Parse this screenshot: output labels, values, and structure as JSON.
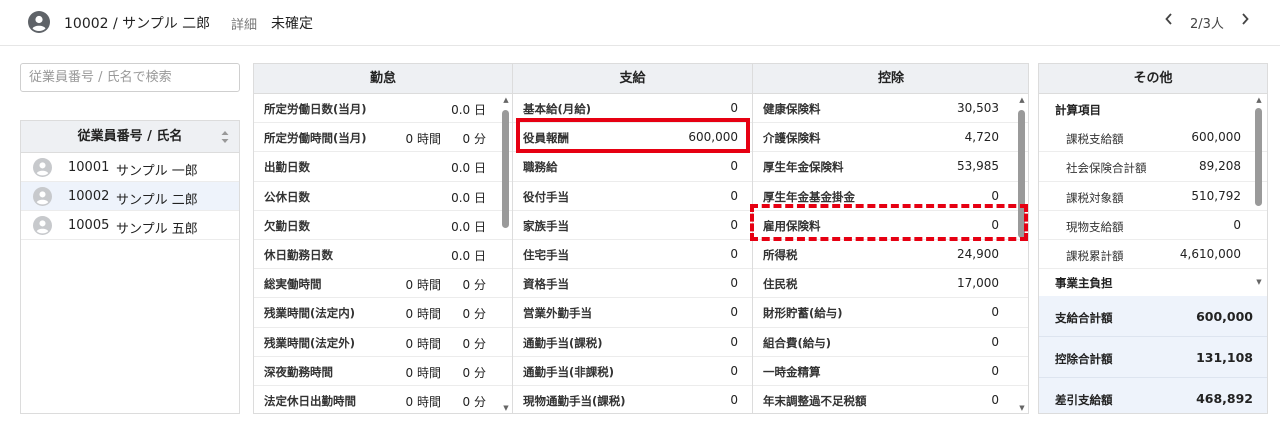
{
  "header": {
    "employee": "10002 / サンプル 二郎",
    "detail_label": "詳細",
    "status": "未確定",
    "pager": {
      "prev_icon": "chevron-left-icon",
      "count": "2/3人",
      "next_icon": "chevron-right-icon"
    }
  },
  "search": {
    "placeholder": "従業員番号 / 氏名で検索",
    "value": ""
  },
  "employee_list": {
    "header": "従業員番号 / 氏名",
    "rows": [
      {
        "id": "10001",
        "name": "サンプル 一郎",
        "selected": false
      },
      {
        "id": "10002",
        "name": "サンプル 二郎",
        "selected": true
      },
      {
        "id": "10005",
        "name": "サンプル 五郎",
        "selected": false
      }
    ]
  },
  "attendance": {
    "title": "勤怠",
    "rows": [
      {
        "label": "所定労働日数(当月)",
        "value": "0.0 日"
      },
      {
        "label": "所定労働時間(当月)",
        "h": "0 時間",
        "m": "0 分"
      },
      {
        "label": "出勤日数",
        "value": "0.0 日"
      },
      {
        "label": "公休日数",
        "value": "0.0 日"
      },
      {
        "label": "欠勤日数",
        "value": "0.0 日"
      },
      {
        "label": "休日勤務日数",
        "value": "0.0 日"
      },
      {
        "label": "総実働時間",
        "h": "0 時間",
        "m": "0 分"
      },
      {
        "label": "残業時間(法定内)",
        "h": "0 時間",
        "m": "0 分"
      },
      {
        "label": "残業時間(法定外)",
        "h": "0 時間",
        "m": "0 分"
      },
      {
        "label": "深夜勤務時間",
        "h": "0 時間",
        "m": "0 分"
      },
      {
        "label": "法定休日出勤時間",
        "h": "0 時間",
        "m": "0 分"
      }
    ]
  },
  "payments": {
    "title": "支給",
    "rows": [
      {
        "label": "基本給(月給)",
        "value": "0"
      },
      {
        "label": "役員報酬",
        "value": "600,000"
      },
      {
        "label": "職務給",
        "value": "0"
      },
      {
        "label": "役付手当",
        "value": "0"
      },
      {
        "label": "家族手当",
        "value": "0"
      },
      {
        "label": "住宅手当",
        "value": "0"
      },
      {
        "label": "資格手当",
        "value": "0"
      },
      {
        "label": "営業外勤手当",
        "value": "0"
      },
      {
        "label": "通勤手当(課税)",
        "value": "0"
      },
      {
        "label": "通勤手当(非課税)",
        "value": "0"
      },
      {
        "label": "現物通勤手当(課税)",
        "value": "0"
      }
    ]
  },
  "deductions": {
    "title": "控除",
    "rows": [
      {
        "label": "健康保険料",
        "value": "30,503"
      },
      {
        "label": "介護保険料",
        "value": "4,720"
      },
      {
        "label": "厚生年金保険料",
        "value": "53,985"
      },
      {
        "label": "厚生年金基金掛金",
        "value": "0"
      },
      {
        "label": "雇用保険料",
        "value": "0"
      },
      {
        "label": "所得税",
        "value": "24,900"
      },
      {
        "label": "住民税",
        "value": "17,000"
      },
      {
        "label": "財形貯蓄(給与)",
        "value": "0"
      },
      {
        "label": "組合費(給与)",
        "value": "0"
      },
      {
        "label": "一時金精算",
        "value": "0"
      },
      {
        "label": "年末調整過不足税額",
        "value": "0"
      }
    ]
  },
  "other": {
    "title": "その他",
    "section1": "計算項目",
    "rows": [
      {
        "label": "課税支給額",
        "value": "600,000"
      },
      {
        "label": "社会保険合計額",
        "value": "89,208"
      },
      {
        "label": "課税対象額",
        "value": "510,792"
      },
      {
        "label": "現物支給額",
        "value": "0"
      },
      {
        "label": "課税累計額",
        "value": "4,610,000"
      }
    ],
    "section2": "事業主負担",
    "totals": [
      {
        "label": "支給合計額",
        "value": "600,000"
      },
      {
        "label": "控除合計額",
        "value": "131,108"
      },
      {
        "label": "差引支給額",
        "value": "468,892"
      }
    ]
  },
  "colors": {
    "highlight": "#e60012",
    "header_bg": "#eef0f3",
    "selected_bg": "#eef3fb"
  }
}
